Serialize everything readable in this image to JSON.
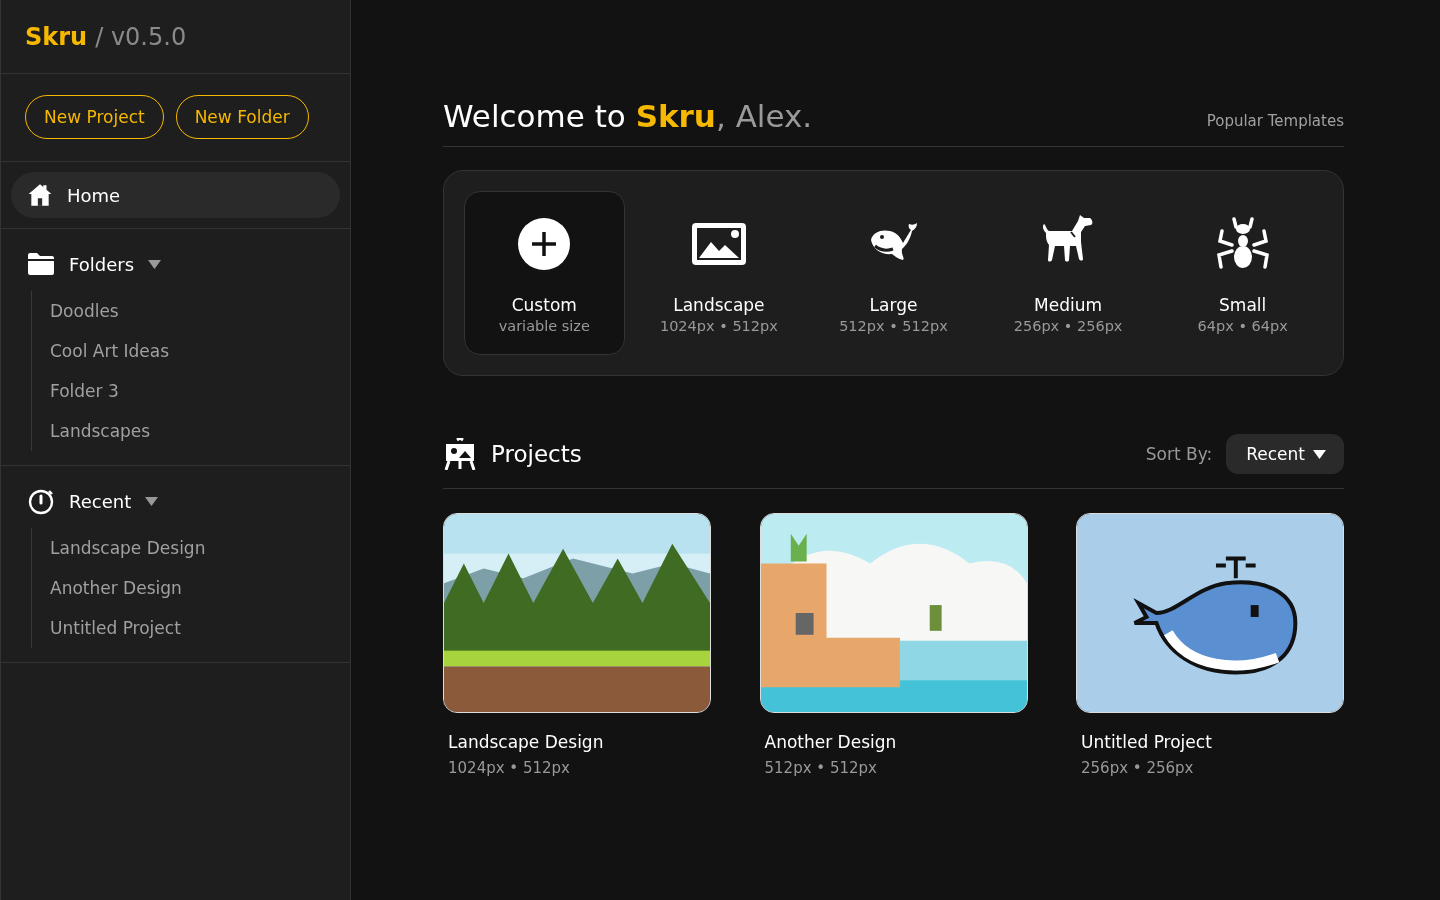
{
  "sidebar": {
    "brand": "Skru",
    "version": "/ v0.5.0",
    "actions": [
      "New Project",
      "New Folder"
    ],
    "nav": [
      {
        "label": "Home",
        "kind": "home",
        "selected": true
      }
    ],
    "groups": [
      {
        "label": "Folders",
        "kind": "folder",
        "expanded": true,
        "items": [
          "Doodles",
          "Cool Art Ideas",
          "Folder 3",
          "Landscapes"
        ]
      },
      {
        "label": "Recent",
        "kind": "timer",
        "expanded": true,
        "items": [
          "Landscape Design",
          "Another Design",
          "Untitled Project"
        ]
      }
    ]
  },
  "welcome": {
    "greeting": "Welcome to ",
    "brand": "Skru",
    "user": ", Alex."
  },
  "templates_link": "Popular Templates",
  "templates": [
    {
      "kind": "plus",
      "name": "Custom",
      "size": "variable size",
      "selected": true
    },
    {
      "kind": "image",
      "name": "Landscape",
      "size": "1024px • 512px",
      "selected": false
    },
    {
      "kind": "whale",
      "name": "Large",
      "size": "512px • 512px",
      "selected": false
    },
    {
      "kind": "dog",
      "name": "Medium",
      "size": "256px • 256px",
      "selected": false
    },
    {
      "kind": "ant",
      "name": "Small",
      "size": "64px • 64px",
      "selected": false
    }
  ],
  "projects": {
    "title": "Projects",
    "sort_label": "Sort By:",
    "sort_value": "Recent",
    "items": [
      {
        "kind": "forest",
        "name": "Landscape Design",
        "size": "1024px • 512px"
      },
      {
        "kind": "platformer",
        "name": "Another Design",
        "size": "512px • 512px"
      },
      {
        "kind": "whale",
        "name": "Untitled Project",
        "size": "256px • 256px"
      }
    ]
  }
}
